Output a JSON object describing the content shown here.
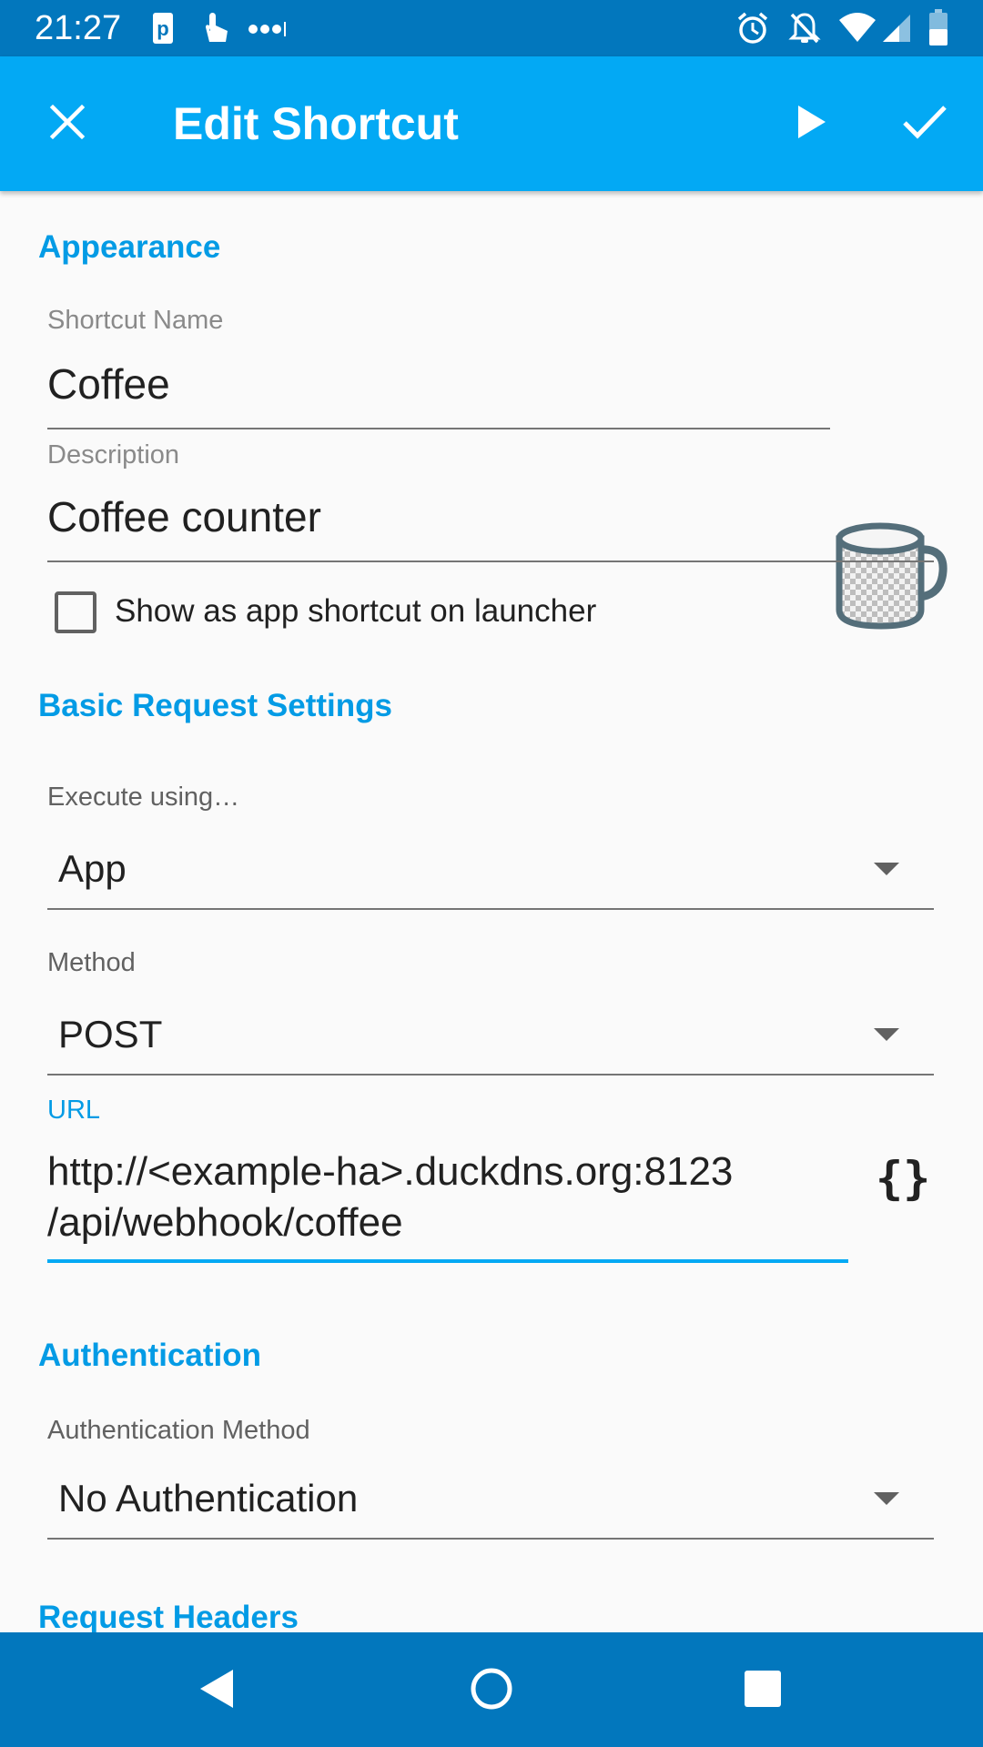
{
  "status_bar": {
    "time": "21:27",
    "left_icons": [
      "parking-icon",
      "touch-icon",
      "more-notifications-icon"
    ],
    "right_icons": [
      "alarm-icon",
      "notifications-off-icon",
      "wifi-icon",
      "cellular-signal-icon",
      "battery-icon"
    ]
  },
  "app_bar": {
    "title": "Edit Shortcut",
    "close_icon": "close-icon",
    "run_icon": "play-icon",
    "save_icon": "check-icon"
  },
  "appearance": {
    "section_title": "Appearance",
    "name_label": "Shortcut Name",
    "name_value": "Coffee",
    "icon": "coffee-mug-icon",
    "description_label": "Description",
    "description_value": "Coffee counter",
    "launcher_checkbox_label": "Show as app shortcut on launcher",
    "launcher_checked": false
  },
  "basic_request": {
    "section_title": "Basic Request Settings",
    "execute_label": "Execute using…",
    "execute_value": "App",
    "method_label": "Method",
    "method_value": "POST",
    "url_label": "URL",
    "url_line1": "http://<example-ha>.duckdns.org:8123",
    "url_line2": "/api/webhook/coffee",
    "variables_button": "{}"
  },
  "authentication": {
    "section_title": "Authentication",
    "method_label": "Authentication Method",
    "method_value": "No Authentication"
  },
  "request_headers": {
    "section_title": "Request Headers"
  },
  "colors": {
    "status_bar": "#0277bd",
    "app_bar": "#03a9f4",
    "accent": "#039be5",
    "nav_bar": "#0277bd"
  }
}
